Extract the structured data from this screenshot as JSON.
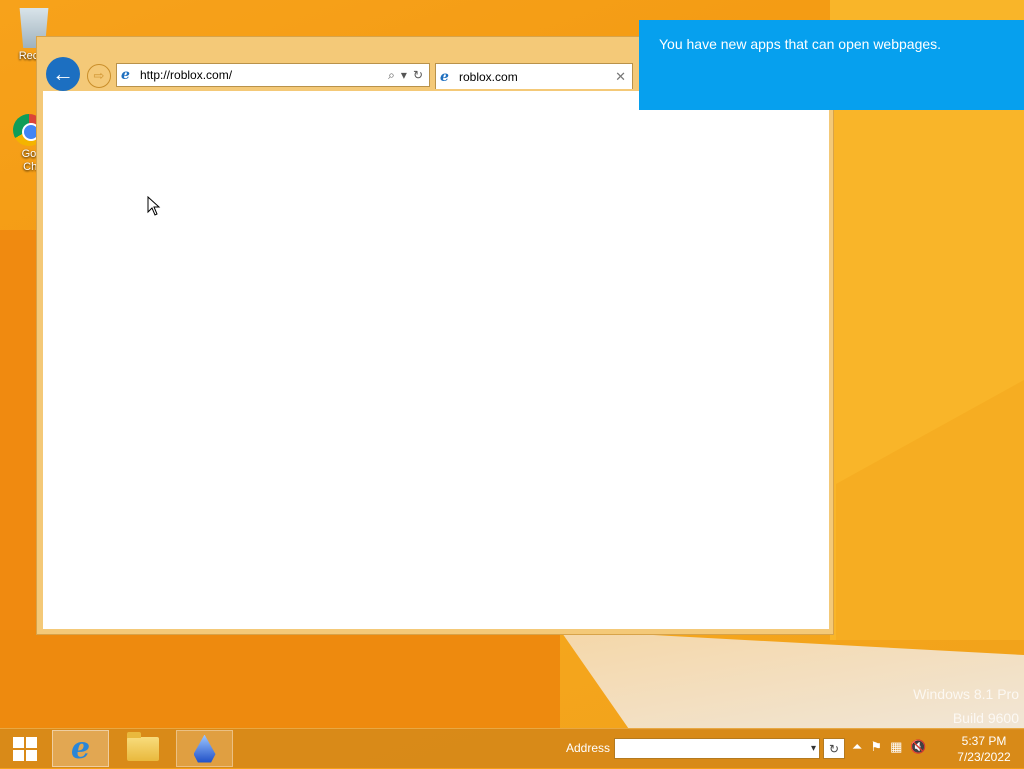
{
  "desktop": {
    "icons": [
      {
        "label": "Recyc",
        "icon": "recycle-bin-icon"
      },
      {
        "label": "Goo Chr",
        "icon": "chrome-icon"
      }
    ],
    "watermark_line1": "Windows 8.1 Pro",
    "watermark_line2": "Build 9600"
  },
  "browser": {
    "address": "http://roblox.com/",
    "tab_label": "roblox.com",
    "back_symbol": "←",
    "forward_symbol": "⇨",
    "close_symbol": "✕",
    "search_symbol": "⌕",
    "dropdown_symbol": "▾",
    "refresh_symbol": "↻",
    "ie_symbol": "e"
  },
  "notification": {
    "text": "You have new apps that can open webpages."
  },
  "taskbar": {
    "address_label": "Address",
    "address_value": "",
    "dropdown_symbol": "▾",
    "refresh_symbol": "↻",
    "ie_symbol": "e",
    "tray_symbols": {
      "up": "⏶",
      "flag": "⚑",
      "network": "▦",
      "volume": "🔇"
    },
    "time": "5:37 PM",
    "date": "7/23/2022"
  },
  "colors": {
    "accent": "#06a0ee",
    "window": "#f4c978",
    "back_button": "#1c6fc1"
  }
}
